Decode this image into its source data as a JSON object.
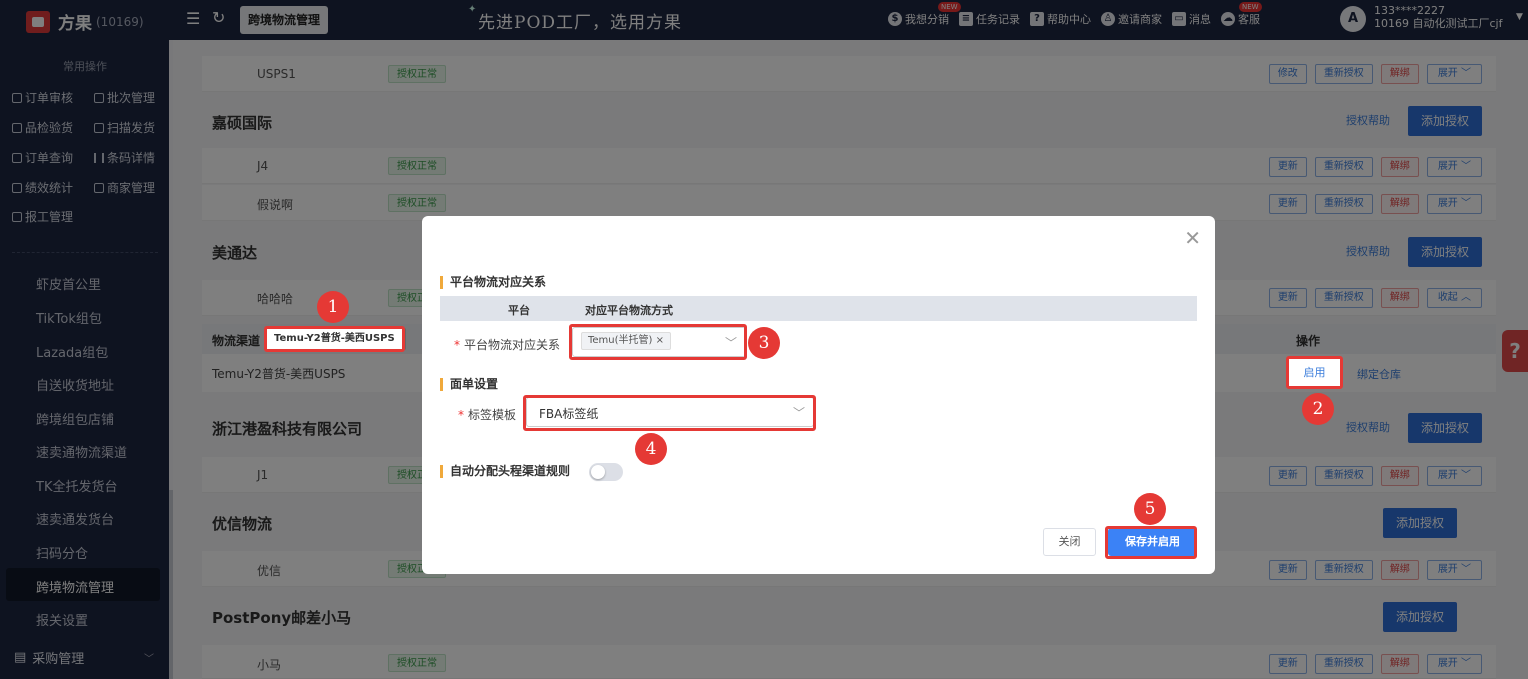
{
  "header": {
    "brand": "方果",
    "brand_id": "(10169)",
    "page_tab": "跨境物流管理",
    "slogan": "先进POD工厂，选用方果",
    "links": [
      {
        "label": "我想分销",
        "icon": "share-icon",
        "new": "NEW"
      },
      {
        "label": "任务记录",
        "icon": "task-icon",
        "new": ""
      },
      {
        "label": "帮助中心",
        "icon": "help-icon",
        "new": ""
      },
      {
        "label": "邀请商家",
        "icon": "invite-icon",
        "new": ""
      },
      {
        "label": "消息",
        "icon": "message-icon",
        "new": ""
      },
      {
        "label": "客服",
        "icon": "service-icon",
        "new": "NEW"
      }
    ],
    "user_avatar": "A",
    "user_phone": "133****2227",
    "user_org": "10169 自动化测试工厂cjf"
  },
  "sidebar": {
    "common_title": "常用操作",
    "quick_ops": [
      "订单审核",
      "批次管理",
      "品检验货",
      "扫描发货",
      "订单查询",
      "条码详情",
      "绩效统计",
      "商家管理",
      "报工管理"
    ],
    "nav": [
      "虾皮首公里",
      "TikTok组包",
      "Lazada组包",
      "自送收货地址",
      "跨境组包店铺",
      "速卖通物流渠道",
      "TK全托发货台",
      "速卖通发货台",
      "扫码分仓",
      "跨境物流管理",
      "报关设置"
    ],
    "active_nav": "跨境物流管理",
    "bottom": "采购管理"
  },
  "main": {
    "usps_row": {
      "name": "USPS1",
      "status": "授权正常",
      "buttons": [
        "修改",
        "重新授权",
        "解绑",
        "展开 ﹀"
      ]
    },
    "sections": [
      {
        "title": "嘉硕国际",
        "help": "授权帮助",
        "add": "添加授权",
        "rows": [
          {
            "name": "J4",
            "status": "授权正常",
            "buttons": [
              "更新",
              "重新授权",
              "解绑",
              "展开 ﹀"
            ]
          },
          {
            "name": "假说啊",
            "status": "授权正常",
            "buttons": [
              "更新",
              "重新授权",
              "解绑",
              "展开 ﹀"
            ]
          }
        ]
      },
      {
        "title": "美通达",
        "help": "授权帮助",
        "add": "添加授权",
        "rows": [
          {
            "name": "哈哈哈",
            "status": "授权正常",
            "buttons": [
              "更新",
              "重新授权",
              "解绑",
              "收起 ︿"
            ]
          }
        ]
      },
      {
        "title": "浙江港盈科技有限公司",
        "help": "授权帮助",
        "add": "添加授权",
        "rows": [
          {
            "name": "J1",
            "status": "授权正常",
            "buttons": [
              "更新",
              "重新授权",
              "解绑",
              "展开 ﹀"
            ]
          }
        ]
      },
      {
        "title": "优信物流",
        "help": "",
        "add": "添加授权",
        "rows": [
          {
            "name": "优信",
            "status": "授权正常",
            "buttons": [
              "更新",
              "重新授权",
              "解绑",
              "展开 ﹀"
            ]
          }
        ]
      },
      {
        "title": "PostPony邮差小马",
        "help": "",
        "add": "添加授权",
        "rows": [
          {
            "name": "小马",
            "status": "授权正常",
            "buttons": [
              "更新",
              "重新授权",
              "解绑",
              "展开 ﹀"
            ]
          }
        ]
      }
    ],
    "channel_table": {
      "col_channel": "物流渠道",
      "filter_value": "Temu-Y2普货-美西USPS",
      "col_action": "操作",
      "row_channel": "Temu-Y2普货-美西USPS",
      "enable": "启用",
      "bind_warehouse": "绑定仓库"
    },
    "help_float": "?"
  },
  "modal": {
    "section1": "平台物流对应关系",
    "col_platform": "平台",
    "col_method": "对应平台物流方式",
    "field_mapping_label": "平台物流对应关系",
    "mapping_chip": "Temu(半托管)",
    "section2": "面单设置",
    "field_template_label": "标签模板",
    "template_value": "FBA标签纸",
    "auto_assign_label": "自动分配头程渠道规则",
    "btn_close": "关闭",
    "btn_save": "保存并启用"
  },
  "annotations": [
    "1",
    "2",
    "3",
    "4",
    "5"
  ],
  "colors": {
    "header_bg": "#1d2640",
    "primary": "#2f6fd6",
    "highlight": "#e53935",
    "accent_bar": "#f0a93b"
  }
}
